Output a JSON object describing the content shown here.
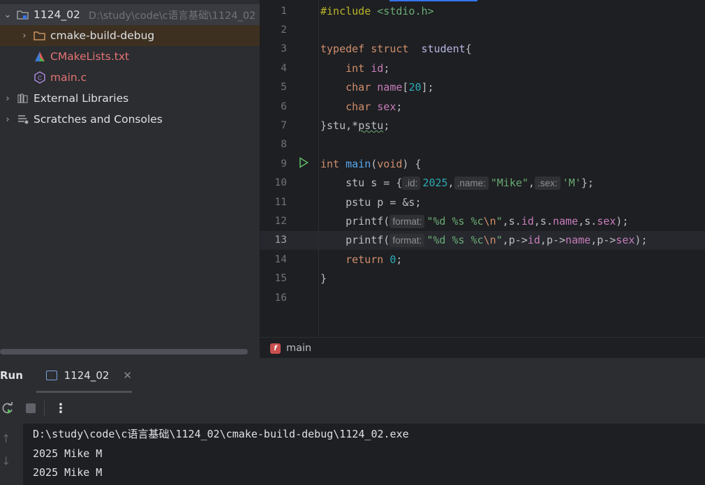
{
  "project_tree": {
    "root": {
      "name": "1124_02",
      "path": "D:\\study\\code\\c语言基础\\1124_02"
    },
    "items": [
      {
        "label": "cmake-build-debug"
      },
      {
        "label": "CMakeLists.txt"
      },
      {
        "label": "main.c"
      },
      {
        "label": "External Libraries"
      },
      {
        "label": "Scratches and Consoles"
      }
    ]
  },
  "editor": {
    "line_numbers": [
      "1",
      "2",
      "3",
      "4",
      "5",
      "6",
      "7",
      "8",
      "9",
      "10",
      "11",
      "12",
      "13",
      "14",
      "15",
      "16"
    ],
    "current_line": "13",
    "hints": {
      "id": ".id:",
      "name": ".name:",
      "sex": ".sex:",
      "format": "format:"
    }
  },
  "breadcrumb": {
    "function": "main"
  },
  "run_panel": {
    "title": "Run",
    "tab_label": "1124_02",
    "console_lines": [
      "D:\\study\\code\\c语言基础\\1124_02\\cmake-build-debug\\1124_02.exe",
      "2025 Mike M",
      "2025 Mike M"
    ]
  },
  "colors": {
    "accent": "#3574f0",
    "run_icon": "#5fb865",
    "cmake": "#e25a5a",
    "c_file": "#b18ce6"
  }
}
